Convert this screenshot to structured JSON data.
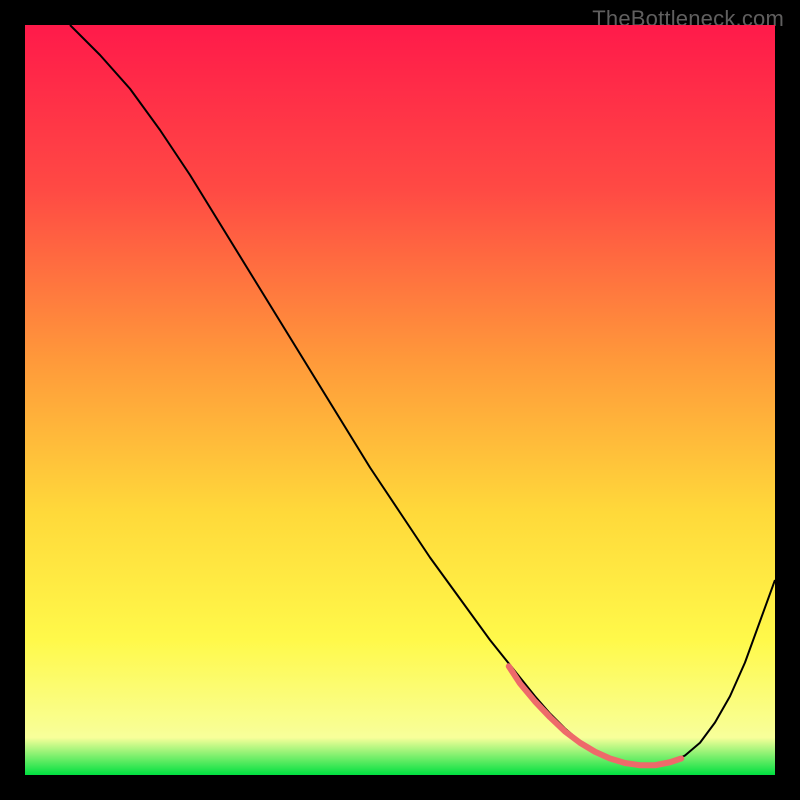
{
  "watermark": "TheBottleneck.com",
  "chart_data": {
    "type": "line",
    "title": "",
    "xlabel": "",
    "ylabel": "",
    "xlim": [
      0,
      100
    ],
    "ylim": [
      0,
      100
    ],
    "gradient_stops": [
      {
        "offset": 0,
        "color": "#ff1a4a"
      },
      {
        "offset": 22,
        "color": "#ff4a44"
      },
      {
        "offset": 45,
        "color": "#ff9a3a"
      },
      {
        "offset": 65,
        "color": "#ffd93a"
      },
      {
        "offset": 82,
        "color": "#fff94a"
      },
      {
        "offset": 95,
        "color": "#f8ff9a"
      },
      {
        "offset": 100,
        "color": "#00e040"
      }
    ],
    "series": [
      {
        "name": "bottleneck-curve",
        "color": "#000000",
        "width": 2,
        "x": [
          6,
          10,
          14,
          18,
          22,
          26,
          30,
          34,
          38,
          42,
          46,
          50,
          54,
          58,
          62,
          64,
          66,
          68,
          70,
          72,
          74,
          76,
          78,
          80,
          82,
          84,
          86,
          88,
          90,
          92,
          94,
          96,
          98,
          100
        ],
        "y": [
          100,
          96,
          91.5,
          86,
          80,
          73.5,
          67,
          60.5,
          54,
          47.5,
          41,
          35,
          29,
          23.5,
          18,
          15.5,
          13,
          10.5,
          8.2,
          6.2,
          4.5,
          3.2,
          2.2,
          1.6,
          1.3,
          1.3,
          1.6,
          2.6,
          4.3,
          7,
          10.5,
          15,
          20.5,
          26
        ]
      },
      {
        "name": "optimal-zone-marker",
        "color": "#ee6a6a",
        "width": 6,
        "linecap": "round",
        "x": [
          64.5,
          66,
          68,
          70,
          72,
          74,
          76,
          78,
          80,
          82,
          84,
          86,
          87.5
        ],
        "y": [
          14.5,
          12.2,
          9.8,
          7.7,
          5.8,
          4.3,
          3.1,
          2.2,
          1.6,
          1.3,
          1.3,
          1.7,
          2.2,
          3.3
        ]
      }
    ]
  }
}
